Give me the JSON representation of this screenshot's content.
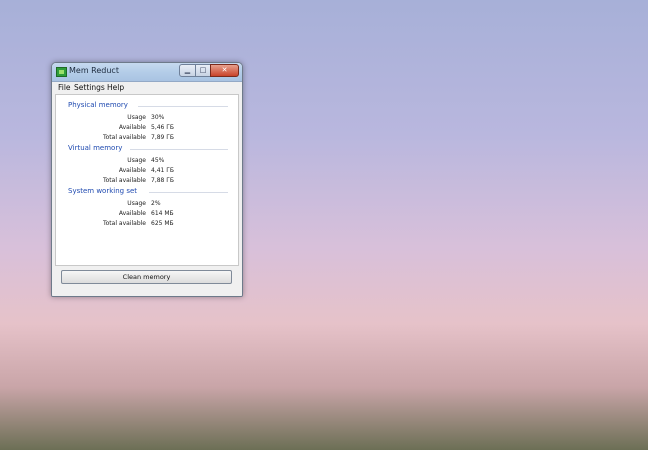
{
  "window": {
    "title": "Mem Reduct",
    "min_glyph": "▁",
    "max_glyph": "□",
    "close_glyph": "✕"
  },
  "menu": {
    "file": "File",
    "settings": "Settings",
    "help": "Help"
  },
  "sections": [
    {
      "title": "Physical memory",
      "rows": [
        {
          "label": "Usage",
          "value": "30%"
        },
        {
          "label": "Available",
          "value": "5,46 ГБ"
        },
        {
          "label": "Total available",
          "value": "7,89 ГБ"
        }
      ]
    },
    {
      "title": "Virtual memory",
      "rows": [
        {
          "label": "Usage",
          "value": "45%"
        },
        {
          "label": "Available",
          "value": "4,41 ГБ"
        },
        {
          "label": "Total available",
          "value": "7,88 ГБ"
        }
      ]
    },
    {
      "title": "System working set",
      "rows": [
        {
          "label": "Usage",
          "value": "2%"
        },
        {
          "label": "Available",
          "value": "614 МБ"
        },
        {
          "label": "Total available",
          "value": "625 МБ"
        }
      ]
    }
  ],
  "buttons": {
    "clean": "Clean memory"
  },
  "icons": {
    "app": "mem-reduct-app-icon"
  }
}
